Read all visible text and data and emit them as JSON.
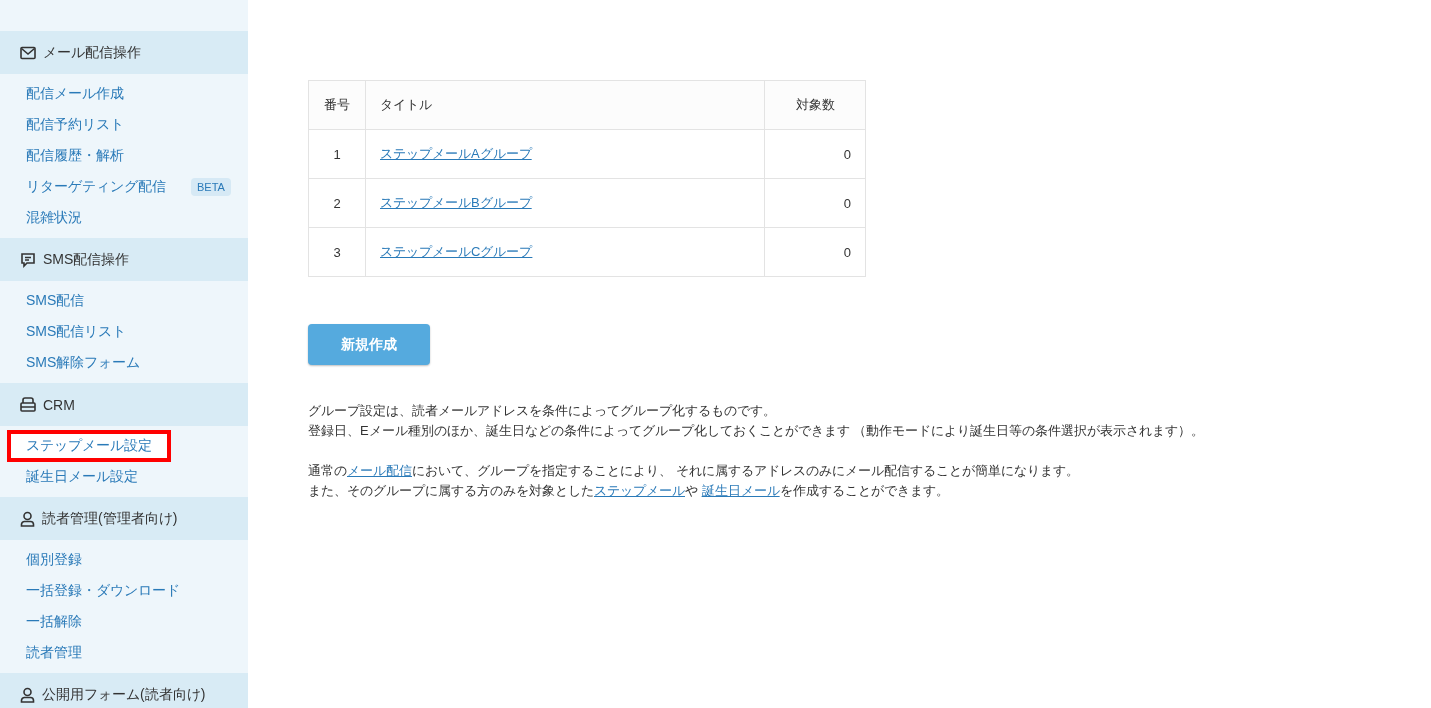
{
  "sidebar": {
    "sections": [
      {
        "title": "メール配信操作",
        "items": [
          {
            "label": "配信メール作成",
            "selected": false
          },
          {
            "label": "配信予約リスト",
            "selected": false
          },
          {
            "label": "配信履歴・解析",
            "selected": false
          },
          {
            "label": "リターゲティング配信",
            "badge": "BETA",
            "selected": false
          },
          {
            "label": "混雑状況",
            "selected": false
          }
        ]
      },
      {
        "title": "SMS配信操作",
        "items": [
          {
            "label": "SMS配信",
            "selected": false
          },
          {
            "label": "SMS配信リスト",
            "selected": false
          },
          {
            "label": "SMS解除フォーム",
            "selected": false
          }
        ]
      },
      {
        "title": "CRM",
        "items": [
          {
            "label": "ステップメール設定",
            "selected": true
          },
          {
            "label": "誕生日メール設定",
            "selected": false
          }
        ]
      },
      {
        "title": "読者管理(管理者向け)",
        "items": [
          {
            "label": "個別登録",
            "selected": false
          },
          {
            "label": "一括登録・ダウンロード",
            "selected": false
          },
          {
            "label": "一括解除",
            "selected": false
          },
          {
            "label": "読者管理",
            "selected": false
          }
        ]
      },
      {
        "title": "公開用フォーム(読者向け)"
      }
    ]
  },
  "table": {
    "columns": [
      "番号",
      "タイトル",
      "対象数"
    ],
    "rows": [
      {
        "number": "1",
        "title": "ステップメールAグループ",
        "count": "0"
      },
      {
        "number": "2",
        "title": "ステップメールBグループ",
        "count": "0"
      },
      {
        "number": "3",
        "title": "ステップメールCグループ",
        "count": "0"
      }
    ]
  },
  "create_button": "新規作成",
  "description": [
    [
      {
        "kind": "text",
        "text": "グループ設定は、読者メールアドレスを条件によってグループ化するものです。"
      }
    ],
    [
      {
        "kind": "text",
        "text": "登録日、Eメール種別のほか、誕生日などの条件によってグループ化しておくことができます （動作モードにより誕生日等の条件選択が表示されます）。"
      }
    ],
    [
      {
        "kind": "text",
        "text": "通常の"
      },
      {
        "kind": "link",
        "text": "メール配信"
      },
      {
        "kind": "text",
        "text": "において、グループを指定することにより、 それに属するアドレスのみにメール配信することが簡単になります。"
      }
    ],
    [
      {
        "kind": "text",
        "text": "また、そのグループに属する方のみを対象とした"
      },
      {
        "kind": "link",
        "text": "ステップメール"
      },
      {
        "kind": "text",
        "text": "や "
      },
      {
        "kind": "link",
        "text": "誕生日メール"
      },
      {
        "kind": "text",
        "text": "を作成することができます。"
      }
    ]
  ]
}
